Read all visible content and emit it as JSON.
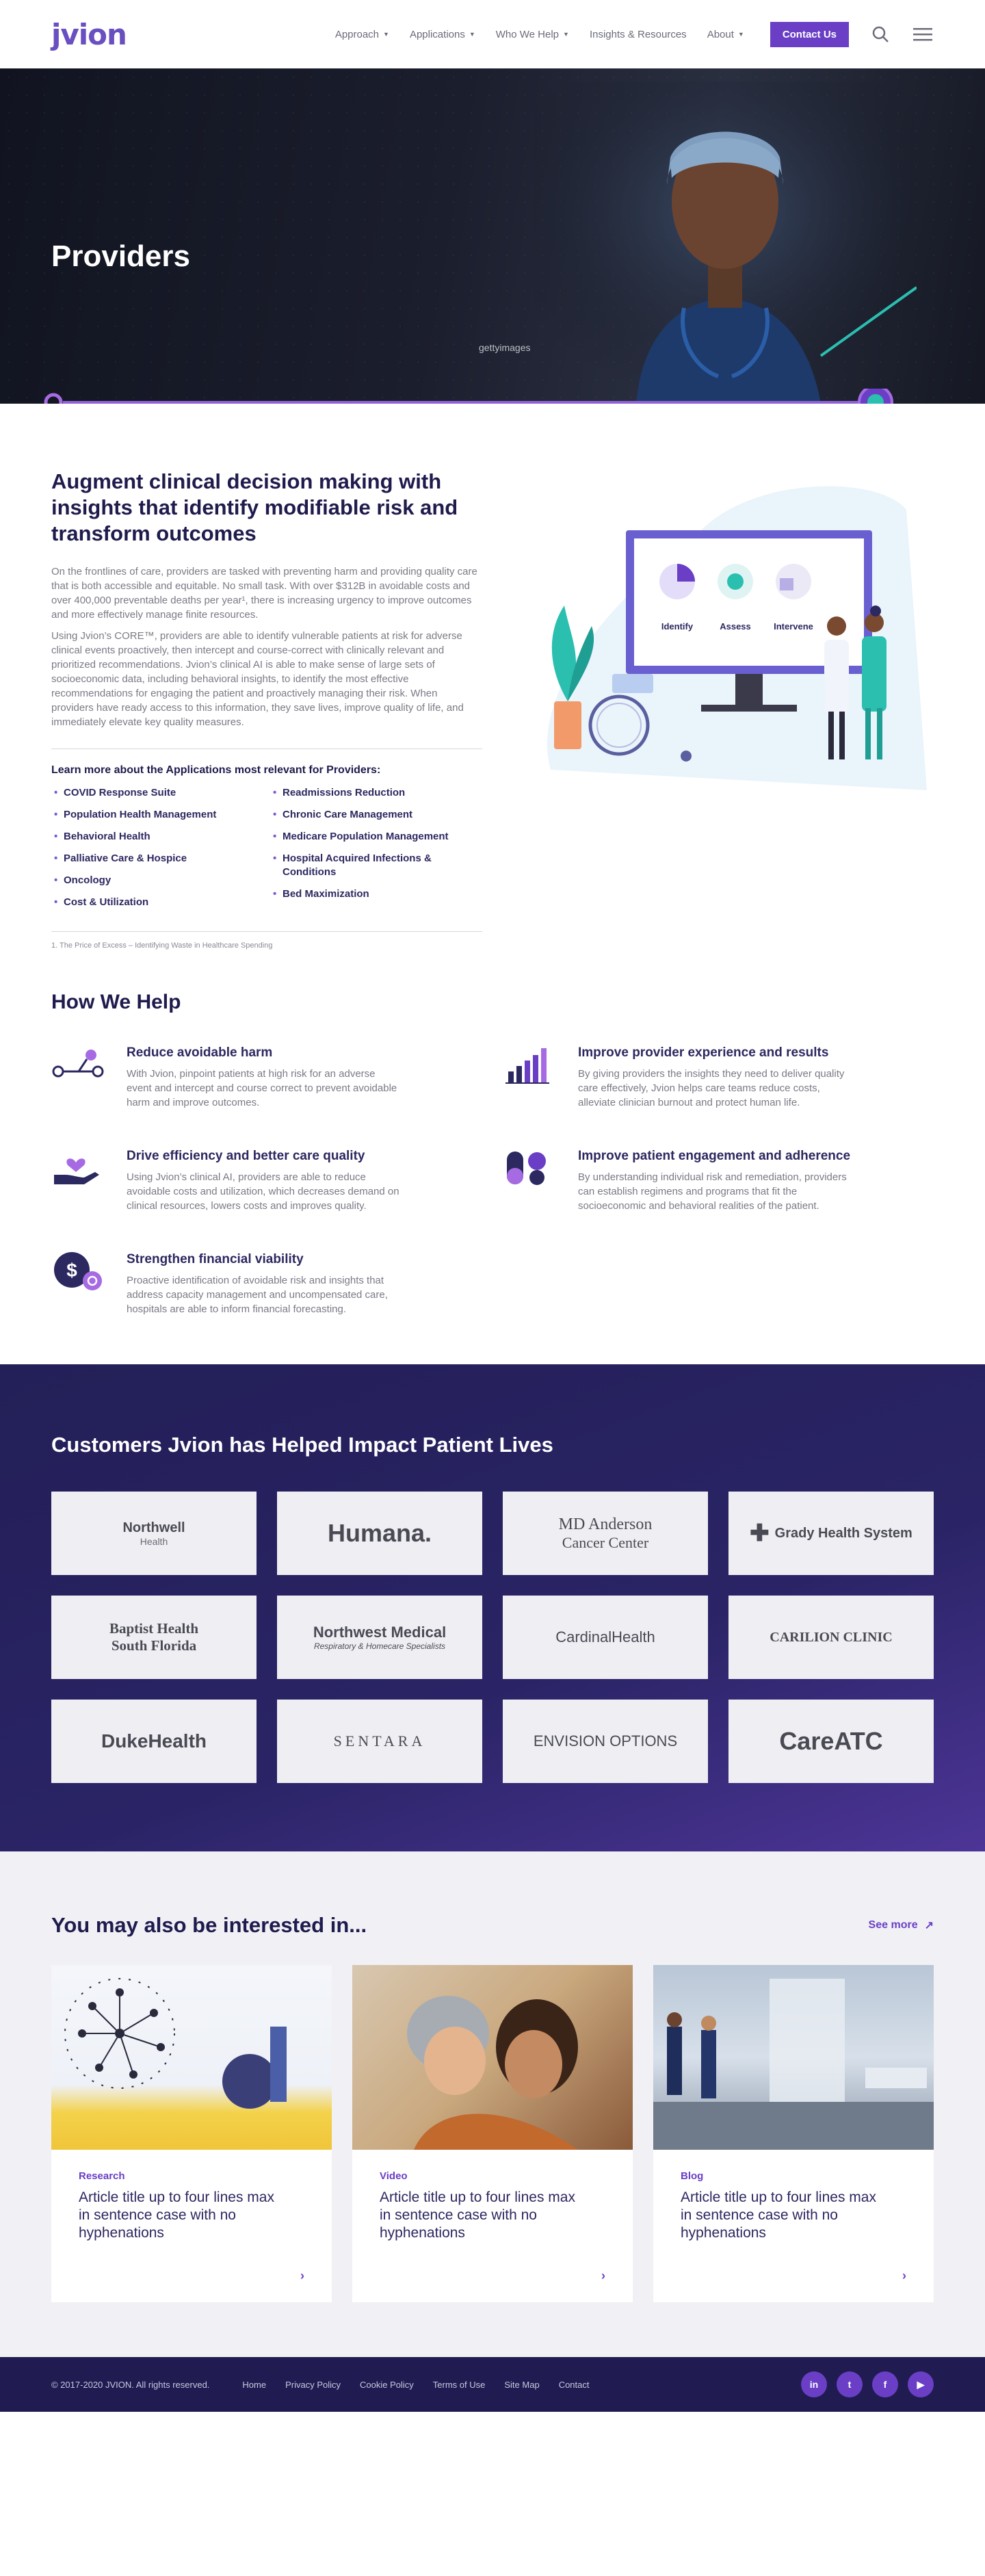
{
  "header": {
    "logo": "jvion",
    "nav": [
      {
        "label": "Approach",
        "caret": true
      },
      {
        "label": "Applications",
        "caret": true
      },
      {
        "label": "Who We Help",
        "caret": true
      },
      {
        "label": "Insights & Resources",
        "caret": false
      },
      {
        "label": "About",
        "caret": true
      }
    ],
    "contact_label": "Contact Us",
    "icons": [
      "search-icon",
      "menu-icon"
    ]
  },
  "hero": {
    "title": "Providers",
    "watermark": "gettyimages"
  },
  "intro": {
    "heading": "Augment clinical decision making with insights that identify modifiable risk and transform outcomes",
    "p1": "On the frontlines of care, providers are tasked with preventing harm and providing quality care that is both accessible and equitable. No small task. With over $312B in avoidable costs and over 400,000 preventable deaths per year¹, there is increasing urgency to improve outcomes and more effectively manage finite resources.",
    "p2": "Using Jvion’s CORE™, providers are able to identify vulnerable patients at risk for adverse clinical events proactively, then intercept and course-correct with clinically relevant and prioritized recommendations. Jvion’s clinical AI is able to make sense of large sets of socioeconomic data, including behavioral insights, to identify the most effective recommendations for engaging the patient and proactively managing their risk. When providers have ready access to this information, they save lives, improve quality of life, and immediately elevate key quality measures.",
    "learn_title": "Learn more about the Applications most relevant for Providers:",
    "apps_left": [
      "COVID Response Suite",
      "Population Health Management",
      "Behavioral Health",
      "Palliative Care & Hospice",
      "Oncology",
      "Cost & Utilization"
    ],
    "apps_right": [
      "Readmissions Reduction",
      "Chronic Care Management",
      "Medicare Population Management",
      "Hospital Acquired Infections & Conditions",
      "Bed Maximization"
    ],
    "footnote": "1. The Price of Excess – Identifying Waste in Healthcare Spending",
    "illustration": {
      "labels": [
        "Identify",
        "Assess",
        "Intervene"
      ]
    }
  },
  "help": {
    "title": "How We Help",
    "items": [
      {
        "icon": "path-icon",
        "title": "Reduce avoidable harm",
        "text": "With Jvion, pinpoint patients at high risk for an adverse event and intercept and course correct to prevent avoidable harm and improve outcomes."
      },
      {
        "icon": "bar-chart-icon",
        "title": "Improve provider experience and results",
        "text": "By giving providers the insights they need to deliver quality care effectively, Jvion helps care teams reduce costs, alleviate clinician burnout and protect human life."
      },
      {
        "icon": "hand-heart-icon",
        "title": "Drive efficiency and better care quality",
        "text": "Using Jvion’s clinical AI, providers are able to reduce avoidable costs and utilization, which decreases demand on clinical resources, lowers costs and improves quality."
      },
      {
        "icon": "pills-icon",
        "title": "Improve patient engagement and adherence",
        "text": "By understanding individual risk and remediation, providers can establish regimens and programs that fit the socioeconomic and behavioral realities of the patient."
      },
      {
        "icon": "dollar-icon",
        "title": "Strengthen financial viability",
        "text": "Proactive identification of avoidable risk and insights that address capacity management and uncompensated care, hospitals are able to inform financial forecasting."
      }
    ]
  },
  "customers": {
    "title": "Customers Jvion has Helped Impact Patient Lives",
    "logos": [
      {
        "name": "Northwell Health",
        "line1": "Northwell",
        "line2": "Health"
      },
      {
        "name": "Humana",
        "line1": "Humana.",
        "line2": ""
      },
      {
        "name": "MD Anderson Cancer Center",
        "line1": "MD Anderson",
        "line2": "Cancer Center"
      },
      {
        "name": "Grady Health System",
        "line1": "Grady Health System",
        "line2": ""
      },
      {
        "name": "Baptist Health South Florida",
        "line1": "Baptist Health",
        "line2": "South Florida"
      },
      {
        "name": "Northwest Medical",
        "line1": "Northwest Medical",
        "line2": "Respiratory & Homecare Specialists"
      },
      {
        "name": "Cardinal Health",
        "line1": "CardinalHealth",
        "line2": ""
      },
      {
        "name": "Carilion Clinic",
        "line1": "CARILION CLINIC",
        "line2": ""
      },
      {
        "name": "Duke Health",
        "line1": "DukeHealth",
        "line2": ""
      },
      {
        "name": "Sentara",
        "line1": "SENTARA",
        "line2": ""
      },
      {
        "name": "Envision Options",
        "line1": "ENVISION OPTIONS",
        "line2": ""
      },
      {
        "name": "CareATC",
        "line1": "CareATC",
        "line2": ""
      }
    ]
  },
  "related": {
    "title": "You may also be interested in...",
    "see_more": "See more",
    "cards": [
      {
        "category": "Research",
        "title": "Article title up to four lines max in sentence case with no hyphenations"
      },
      {
        "category": "Video",
        "title": "Article title up to four lines max in sentence case with no hyphenations"
      },
      {
        "category": "Blog",
        "title": "Article title up to four lines max in sentence case with no hyphenations"
      }
    ]
  },
  "footer": {
    "copyright": "© 2017-2020 JVION. All rights reserved.",
    "links": [
      "Home",
      "Privacy Policy",
      "Cookie Policy",
      "Terms of Use",
      "Site Map",
      "Contact"
    ],
    "social": [
      "linkedin-icon",
      "twitter-icon",
      "facebook-icon",
      "youtube-icon"
    ],
    "colors": {
      "accent": "#6a3fc6",
      "navy": "#201c52",
      "teal": "#2bbfb0"
    }
  }
}
